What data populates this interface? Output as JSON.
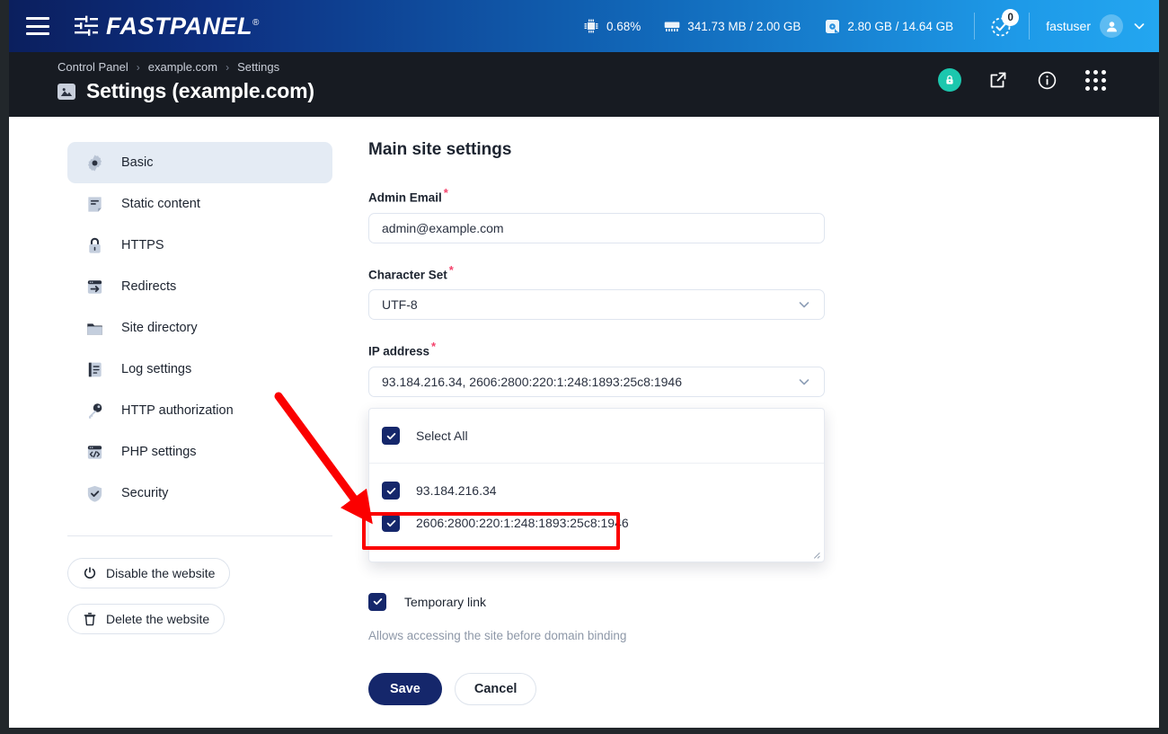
{
  "topbar": {
    "menu_icon": "hamburger-icon",
    "brand": "FASTPANEL",
    "brand_reg": "®",
    "stats": [
      {
        "icon": "cpu-icon",
        "value": "0.68%"
      },
      {
        "icon": "ram-icon",
        "value": "341.73 MB / 2.00 GB"
      },
      {
        "icon": "disk-icon",
        "value": "2.80 GB / 14.64 GB"
      }
    ],
    "notifications": {
      "icon": "task-check-icon",
      "count": "0"
    },
    "user": {
      "name": "fastuser",
      "avatar_icon": "user-avatar-icon",
      "chevron_icon": "chevron-down-icon"
    }
  },
  "pagehead": {
    "breadcrumb": [
      {
        "label": "Control Panel",
        "link": true
      },
      {
        "label": "example.com",
        "link": true
      },
      {
        "label": "Settings",
        "link": false
      }
    ],
    "separator": "›",
    "title_icon": "site-image-icon",
    "title": "Settings (example.com)",
    "actions": [
      {
        "name": "ssl-lock-button",
        "icon": "lock-icon"
      },
      {
        "name": "open-site-button",
        "icon": "external-link-icon"
      },
      {
        "name": "info-button",
        "icon": "info-circle-icon"
      },
      {
        "name": "apps-grid-button",
        "icon": "grid-dots-icon"
      }
    ],
    "accent_teal": "#1cc7ae"
  },
  "sidebar": {
    "items": [
      {
        "label": "Basic",
        "icon": "gear-icon",
        "active": true
      },
      {
        "label": "Static content",
        "icon": "document-icon",
        "active": false
      },
      {
        "label": "HTTPS",
        "icon": "lock-icon",
        "active": false
      },
      {
        "label": "Redirects",
        "icon": "redirect-arrow-icon",
        "active": false
      },
      {
        "label": "Site directory",
        "icon": "folder-icon",
        "active": false
      },
      {
        "label": "Log settings",
        "icon": "log-list-icon",
        "active": false
      },
      {
        "label": "HTTP authorization",
        "icon": "key-icon",
        "active": false
      },
      {
        "label": "PHP settings",
        "icon": "code-window-icon",
        "active": false
      },
      {
        "label": "Security",
        "icon": "shield-check-icon",
        "active": false
      }
    ],
    "buttons": [
      {
        "label": "Disable the website",
        "icon": "power-icon"
      },
      {
        "label": "Delete the website",
        "icon": "trash-icon"
      }
    ]
  },
  "main": {
    "section_title": "Main site settings",
    "fields": {
      "admin_email": {
        "label": "Admin Email",
        "required": "*",
        "value": "admin@example.com",
        "placeholder": "Admin Email"
      },
      "charset": {
        "label": "Character Set",
        "required": "*",
        "value": "UTF-8",
        "chevron_icon": "chevron-down-icon"
      },
      "ip_address": {
        "label": "IP address",
        "required": "*",
        "value": "93.184.216.34, 2606:2800:220:1:248:1893:25c8:1946",
        "chevron_icon": "chevron-down-icon",
        "dropdown_open": true,
        "options": [
          {
            "label": "Select All",
            "checked": true,
            "is_select_all": true
          },
          {
            "label": "93.184.216.34",
            "checked": true,
            "is_select_all": false
          },
          {
            "label": "2606:2800:220:1:248:1893:25c8:1946",
            "checked": true,
            "is_select_all": false
          }
        ]
      }
    },
    "temporary_link": {
      "label": "Temporary link",
      "checked": true,
      "helper": "Allows accessing the site before domain binding"
    },
    "save_label": "Save",
    "cancel_label": "Cancel"
  },
  "annotations": {
    "highlight_color": "#fb0000",
    "arrow_target": "2606:2800:220:1:248:1893:25c8:1946"
  }
}
